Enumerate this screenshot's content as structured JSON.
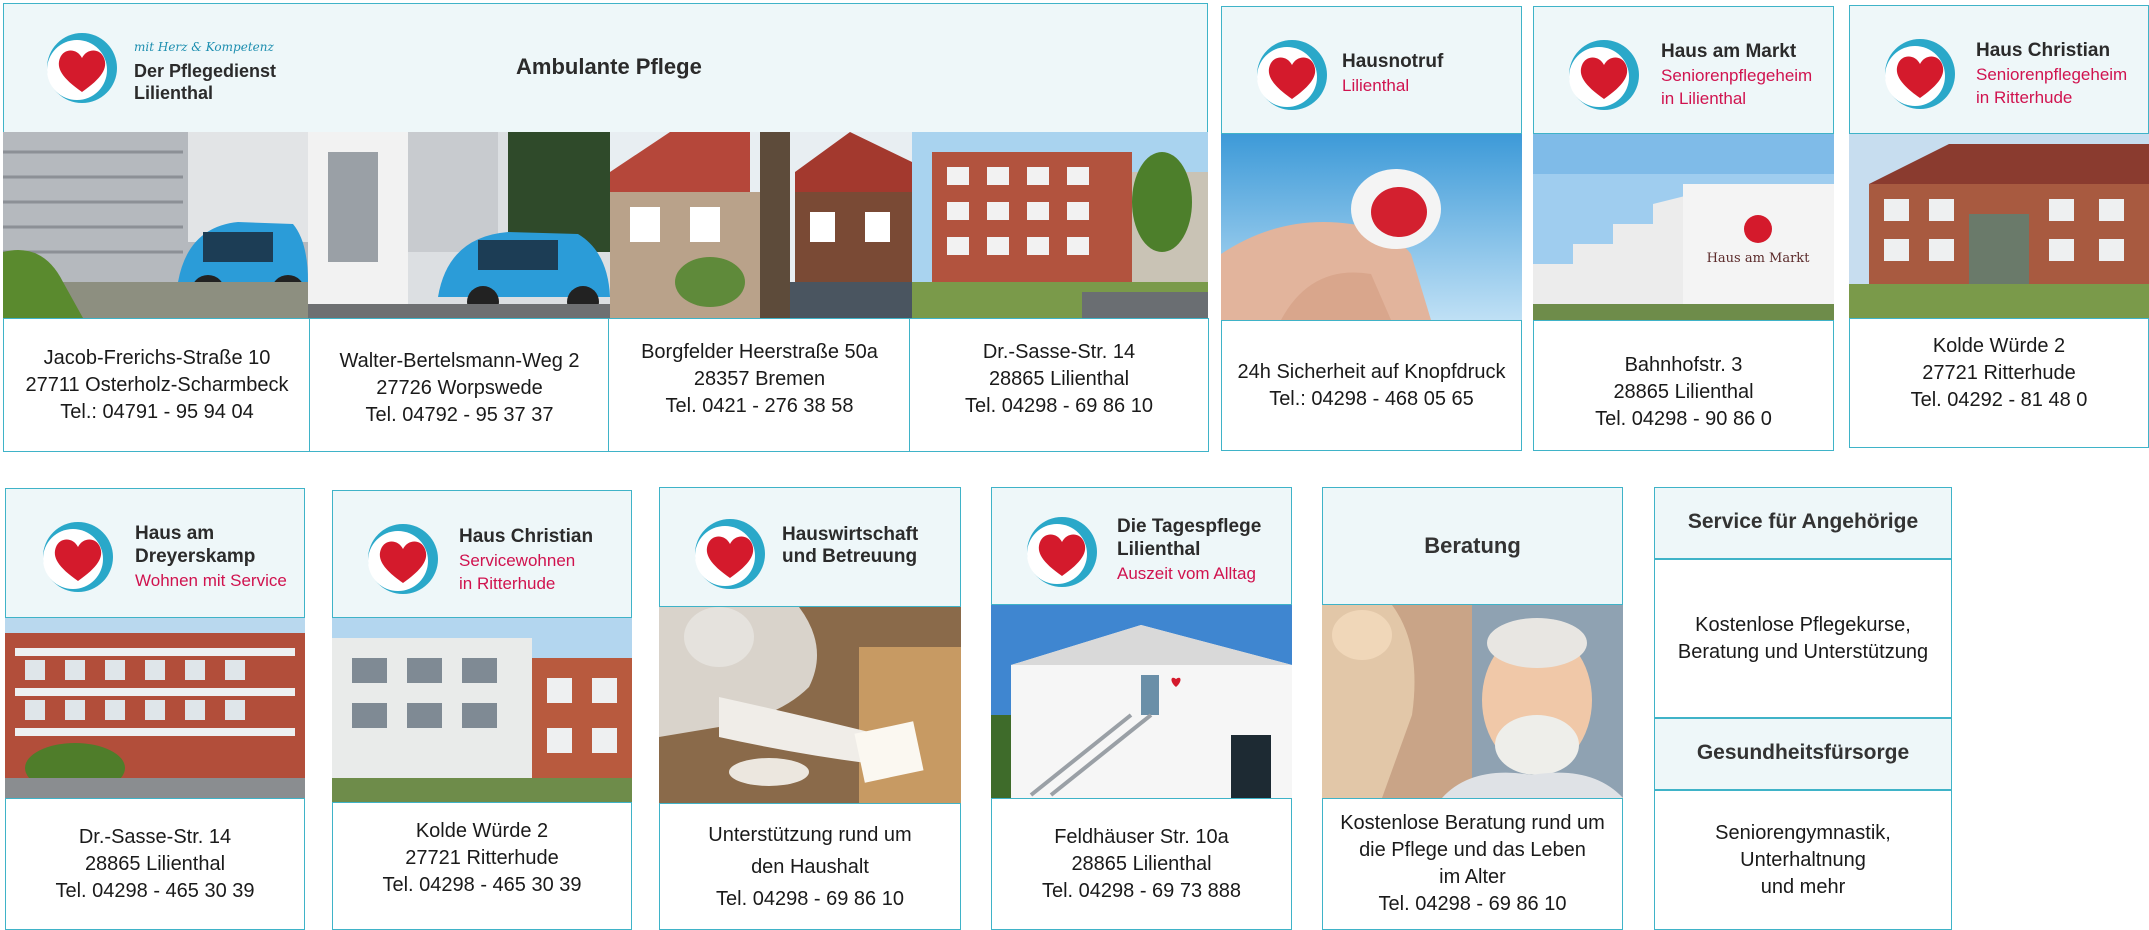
{
  "top": {
    "pflegedienst": {
      "slogan": "mit Herz & Kompetenz",
      "name_line1": "Der Pflegedienst",
      "name_line2": "Lilienthal",
      "heading": "Ambulante Pflege",
      "locations": [
        {
          "street": "Jacob-Frerichs-Straße 10",
          "city": "27711 Osterholz-Scharmbeck",
          "phone": "Tel.: 04791 - 95 94 04"
        },
        {
          "street": "Walter-Bertelsmann-Weg 2",
          "city": "27726 Worpswede",
          "phone": "Tel. 04792 - 95 37 37"
        },
        {
          "street": "Borgfelder Heerstraße 50a",
          "city": "28357 Bremen",
          "phone": "Tel. 0421 - 276 38 58"
        },
        {
          "street": "Dr.-Sasse-Str. 14",
          "city": "28865 Lilienthal",
          "phone": "Tel. 04298 - 69 86 10"
        }
      ]
    },
    "hausnotruf": {
      "title": "Hausnotruf",
      "subtitle": "Lilienthal",
      "line1": "24h Sicherheit auf Knopfdruck",
      "line2": "Tel.: 04298 - 468 05 65"
    },
    "haus_am_markt": {
      "title": "Haus am Markt",
      "subtitle1": "Seniorenpflegeheim",
      "subtitle2": "in Lilienthal",
      "sign": "Haus am Markt",
      "street": "Bahnhofstr. 3",
      "city": "28865 Lilienthal",
      "phone": "Tel.  04298 - 90 86 0"
    },
    "haus_christian": {
      "title": "Haus Christian",
      "subtitle1": "Seniorenpflegeheim",
      "subtitle2": "in Ritterhude",
      "street": "Kolde Würde 2",
      "city": "27721 Ritterhude",
      "phone": "Tel. 04292 - 81 48 0"
    }
  },
  "bottom": {
    "dreyerskamp": {
      "title1": "Haus am",
      "title2": "Dreyerskamp",
      "subtitle": "Wohnen mit Service",
      "street": "Dr.-Sasse-Str. 14",
      "city": "28865 Lilienthal",
      "phone": "Tel. 04298 - 465 30 39"
    },
    "servicewohnen": {
      "title": "Haus Christian",
      "subtitle1": "Servicewohnen",
      "subtitle2": "in Ritterhude",
      "street": "Kolde Würde 2",
      "city": "27721 Ritterhude",
      "phone": "Tel. 04298 - 465 30 39"
    },
    "hauswirtschaft": {
      "title1": "Hauswirtschaft",
      "title2": "und Betreuung",
      "line1": "Unterstützung rund um",
      "line2": "den Haushalt",
      "phone": "Tel. 04298 - 69 86 10"
    },
    "tagespflege": {
      "title1": "Die Tagespflege",
      "title2": "Lilienthal",
      "subtitle": "Auszeit vom Alltag",
      "street": "Feldhäuser Str. 10a",
      "city": "28865 Lilienthal",
      "phone": "Tel.  04298 - 69 73 888"
    },
    "beratung": {
      "title": "Beratung",
      "line1": "Kostenlose Beratung rund um",
      "line2": "die Pflege und das Leben",
      "line3": "im Alter",
      "phone": "Tel. 04298 - 69 86 10"
    },
    "angehoerige": {
      "title": "Service für Angehörige",
      "line1": "Kostenlose Pflegekurse,",
      "line2": "Beratung und Unterstützung"
    },
    "gesundheit": {
      "title": "Gesundheitsfürsorge",
      "line1": "Seniorengymnastik,",
      "line2": "Unterhaltnung",
      "line3": "und mehr"
    }
  },
  "colors": {
    "accent_border": "#3fb3c8",
    "header_bg": "#eef7f9",
    "subtitle_red": "#d0134f",
    "heart_red": "#d41a2c",
    "circle_blue": "#2aa8c9"
  },
  "icons": [
    "heart-logo-icon"
  ]
}
